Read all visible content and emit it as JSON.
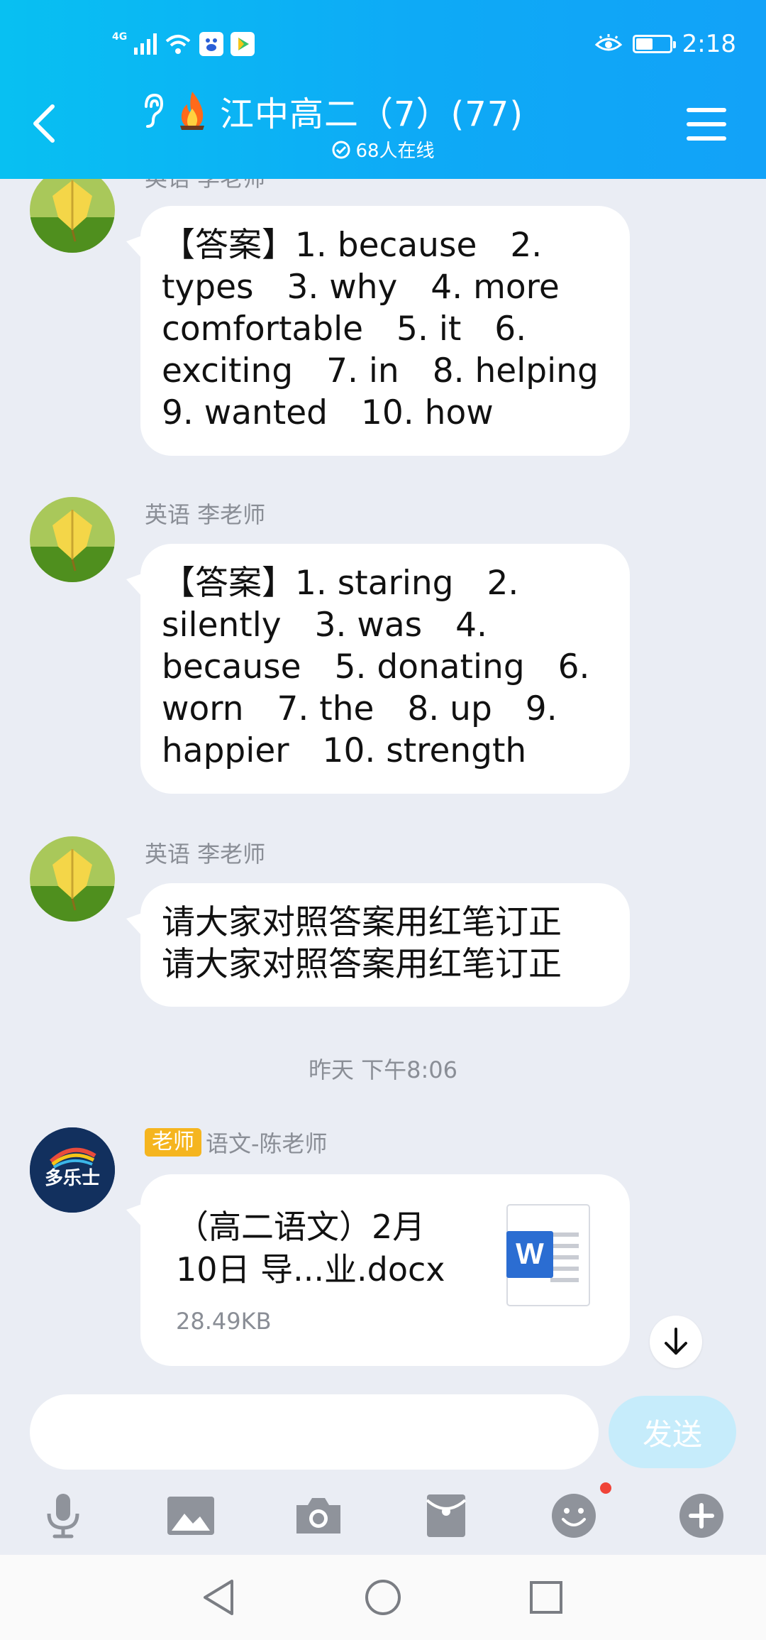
{
  "status_bar": {
    "network": "4G",
    "time": "2:18",
    "battery_level": 0.5
  },
  "header": {
    "title": "江中高二（7）(77)",
    "online": "68人在线"
  },
  "messages": [
    {
      "sender": "英语 李老师",
      "text": "【答案】1. because　2.\ntypes　3. why　4. more\ncomfortable　5. it　6.\nexciting　7. in　8. helping\n9. wanted　10. how"
    },
    {
      "sender": "英语 李老师",
      "text": "【答案】1. staring　2.\nsilently　3. was　4.\nbecause　5. donating　6.\nworn　7. the　8. up　9.\nhappier　10. strength"
    },
    {
      "sender": "英语 李老师",
      "text": "请大家对照答案用红笔订正\n请大家对照答案用红笔订正"
    }
  ],
  "timestamp": "昨天 下午8:06",
  "file_message": {
    "tag": "老师",
    "sender": "语文-陈老师",
    "avatar_text": "多乐士",
    "file_name": "（高二语文）2月\n10日 导...业.docx",
    "file_size": "28.49KB",
    "file_icon_letter": "W"
  },
  "input": {
    "placeholder": "",
    "send_label": "发送"
  },
  "colors": {
    "header_start": "#08c0f2",
    "header_end": "#12a2f8",
    "background": "#eaedf4",
    "tag": "#f5b51f",
    "send_disabled": "#c6ecfb",
    "word_blue": "#2b6dd2",
    "toolbar_gray": "#8f939b"
  },
  "toolbar": [
    "microphone-icon",
    "image-icon",
    "camera-icon",
    "red-envelope-icon",
    "emoji-icon",
    "plus-icon"
  ]
}
